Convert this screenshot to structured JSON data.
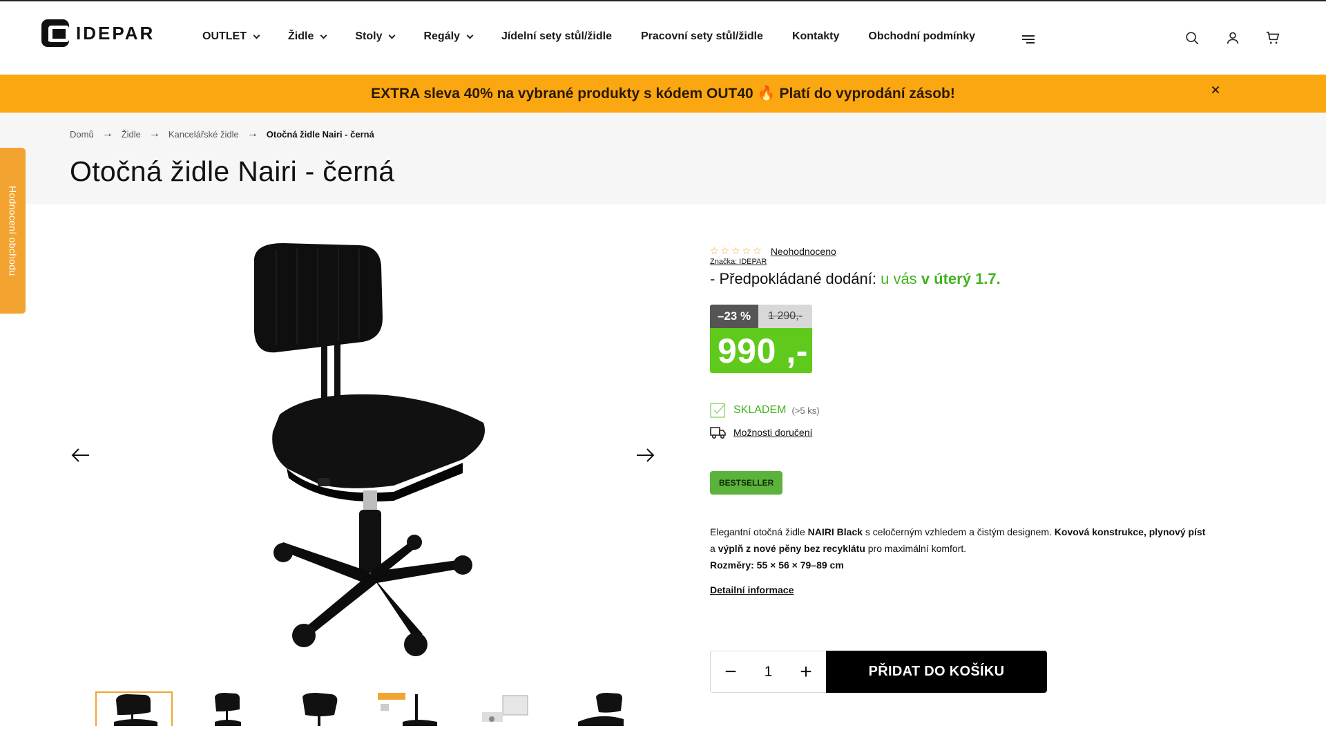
{
  "header": {
    "logo_text": "IDEPAR",
    "nav": [
      {
        "label": "OUTLET",
        "has_dropdown": true
      },
      {
        "label": "Židle",
        "has_dropdown": true
      },
      {
        "label": "Stoly",
        "has_dropdown": true
      },
      {
        "label": "Regály",
        "has_dropdown": true
      },
      {
        "label": "Jídelní sety stůl/židle",
        "has_dropdown": false
      },
      {
        "label": "Pracovní sety stůl/židle",
        "has_dropdown": false
      },
      {
        "label": "Kontakty",
        "has_dropdown": false
      },
      {
        "label": "Obchodní podmínky",
        "has_dropdown": false
      }
    ],
    "icons": [
      "menu-icon",
      "search-icon",
      "user-icon",
      "cart-icon"
    ]
  },
  "promo": {
    "text": "EXTRA sleva 40% na vybrané produkty s kódem OUT40 🔥 Platí do vyprodání zásob!",
    "background": "#fba711"
  },
  "breadcrumb": [
    "Domů",
    "Židle",
    "Kancelářské židle",
    "Otočná židle Nairi - černá"
  ],
  "side_tab": {
    "label": "Hodnocení obchodu"
  },
  "product": {
    "title": "Otočná židle Nairi - černá",
    "rating_text": "Neohodnoceno",
    "stars": 5,
    "brand": "Značka: IDEPAR",
    "delivery_prefix": "- Předpokládané dodání:",
    "delivery_at": "u vás",
    "delivery_date": "v úterý 1.7.",
    "discount": "–23 %",
    "old_price": "1 290,-",
    "price": "990 ,-",
    "stock_label": "SKLADEM",
    "stock_qty": "(>5 ks)",
    "delivery_options": "Možnosti doručení",
    "badge": "BESTSELLER",
    "description": {
      "p1_a": "Elegantní otočná židle ",
      "p1_b": "NAIRI Black",
      "p1_c": " s celočerným vzhledem a čistým designem. ",
      "p1_d": "Kovová konstrukce",
      "p1_e": ", ",
      "p1_f": "plynový píst",
      "p1_g": " a ",
      "p1_h": "výplň z nové pěny bez recyklátu",
      "p1_i": " pro maximální komfort.",
      "dims": "Rozměry: 55 × 56 × 79–89 cm"
    },
    "detail_link": "Detailní informace",
    "quantity": "1",
    "add_to_cart": "PŘIDAT DO KOŠÍKU",
    "thumbnails": 6
  },
  "colors": {
    "accent_green": "#5fca1c",
    "text_green": "#44b21f",
    "promo_orange": "#fba711",
    "side_tab_orange": "#f3a330"
  }
}
